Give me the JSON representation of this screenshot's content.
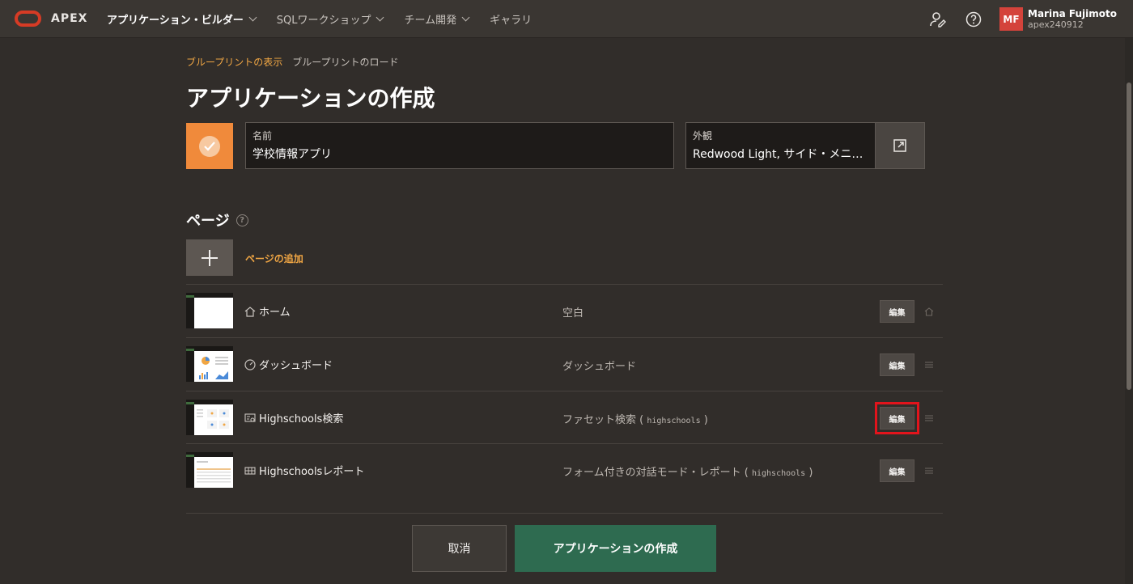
{
  "header": {
    "logo_text": "APEX",
    "nav": [
      {
        "label": "アプリケーション・ビルダー",
        "active": true
      },
      {
        "label": "SQLワークショップ",
        "active": false
      },
      {
        "label": "チーム開発",
        "active": false
      },
      {
        "label": "ギャラリ",
        "active": false
      }
    ],
    "user": {
      "initials": "MF",
      "name": "Marina Fujimoto",
      "workspace": "apex240912"
    }
  },
  "breadcrumb": {
    "link": "ブループリントの表示",
    "current": "ブループリントのロード"
  },
  "title": "アプリケーションの作成",
  "name_field": {
    "label": "名前",
    "value": "学校情報アプリ"
  },
  "appearance_field": {
    "label": "外観",
    "value": "Redwood Light, サイド・メニュー"
  },
  "pages_section": {
    "title": "ページ",
    "help": "?",
    "add_label": "ページの追加",
    "edit_label": "編集",
    "rows": [
      {
        "name": "ホーム",
        "type": "空白",
        "type_param": "",
        "icon": "home-icon"
      },
      {
        "name": "ダッシュボード",
        "type": "ダッシュボード",
        "type_param": "",
        "icon": "dashboard-icon"
      },
      {
        "name": "Highschools検索",
        "type": "ファセット検索 (",
        "type_param": "highschools",
        "type_suffix": ")",
        "icon": "faceted-search-icon"
      },
      {
        "name": "Highschoolsレポート",
        "type": "フォーム付きの対話モード・レポート (",
        "type_param": "highschools",
        "type_suffix": ")",
        "icon": "report-icon"
      }
    ]
  },
  "footer": {
    "cancel": "取消",
    "create": "アプリケーションの作成"
  },
  "colors": {
    "accent": "#f0a644",
    "create": "#2e6b50",
    "highlight": "#e2141c",
    "app_icon": "#f08a3b"
  }
}
